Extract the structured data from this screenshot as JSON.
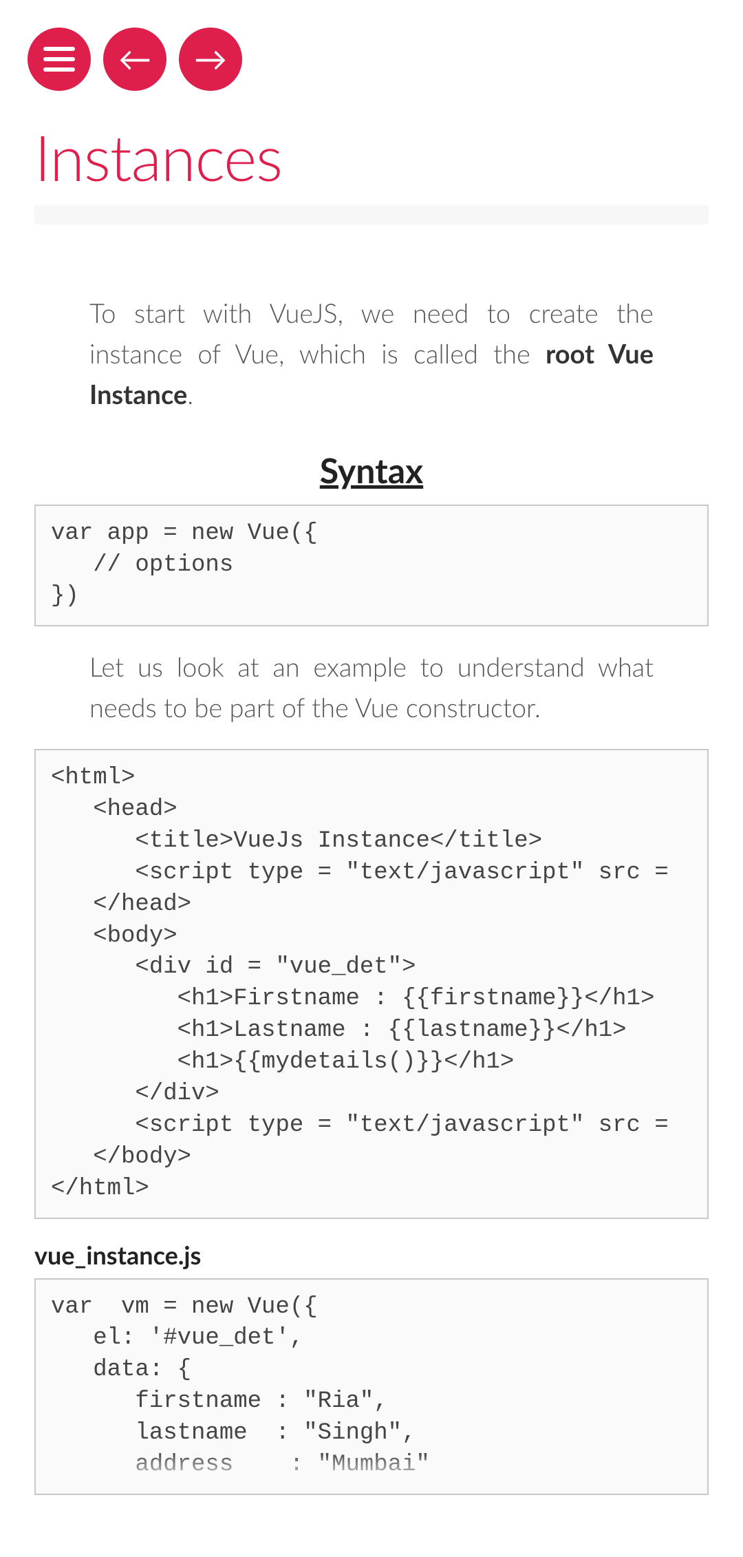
{
  "page_title": "Instances",
  "intro_pre": "To start with VueJS, we need to create the instance of Vue, which is called the ",
  "intro_strong": "root Vue Instance",
  "intro_post": ".",
  "syntax_heading": "Syntax",
  "syntax_code": "var app = new Vue({\n   // options\n})",
  "example_intro": "Let us look at an example to understand what needs to be part of the Vue constructor.",
  "html_code": "<html>\n   <head>\n      <title>VueJs Instance</title>\n      <script type = \"text/javascript\" src =\n   </head>\n   <body>\n      <div id = \"vue_det\">\n         <h1>Firstname : {{firstname}}</h1>\n         <h1>Lastname : {{lastname}}</h1>\n         <h1>{{mydetails()}}</h1>\n      </div>\n      <script type = \"text/javascript\" src =\n   </body>\n</html>",
  "js_filename": "vue_instance.js",
  "js_code": "var  vm = new Vue({\n   el: '#vue_det',\n   data: {\n      firstname : \"Ria\",\n      lastname  : \"Singh\",\n      address    : \"Mumbai\""
}
